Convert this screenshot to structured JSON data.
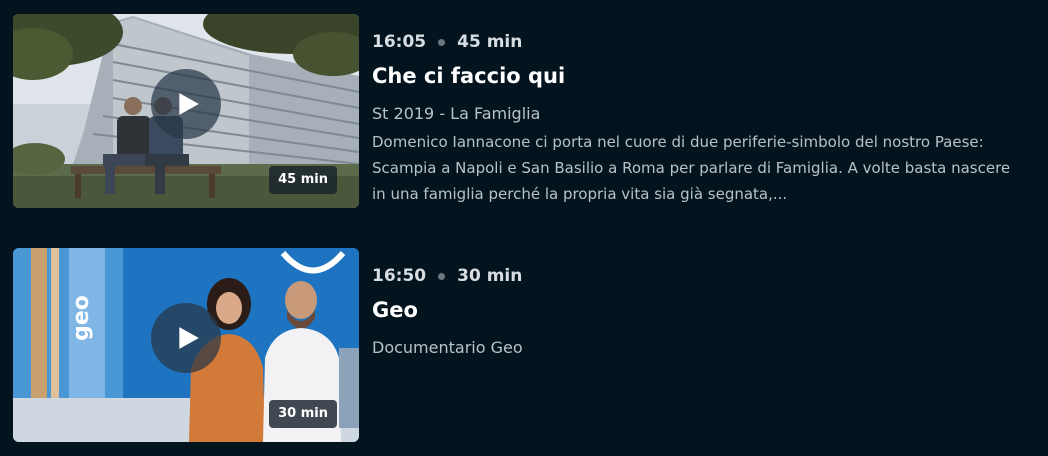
{
  "programs": [
    {
      "time": "16:05",
      "duration": "45 min",
      "title": "Che ci faccio qui",
      "subtitle": "St 2019 - La Famiglia",
      "description": "Domenico Iannacone ci porta nel cuore di due periferie-simbolo del nostro Paese: Scampia a Napoli e San Basilio a Roma per parlare di Famiglia. A volte basta nascere in una famiglia perché la propria vita sia già segnata,...",
      "badge": "45 min",
      "play_icon": "play-icon"
    },
    {
      "time": "16:50",
      "duration": "30 min",
      "title": "Geo",
      "subtitle": "Documentario Geo",
      "badge": "30 min",
      "play_icon": "play-icon",
      "thumb_logo_text": "geo"
    }
  ],
  "colors": {
    "background": "#04141f",
    "text_primary": "#ffffff",
    "text_secondary": "#b9c1c8",
    "dot": "#6b7680"
  }
}
